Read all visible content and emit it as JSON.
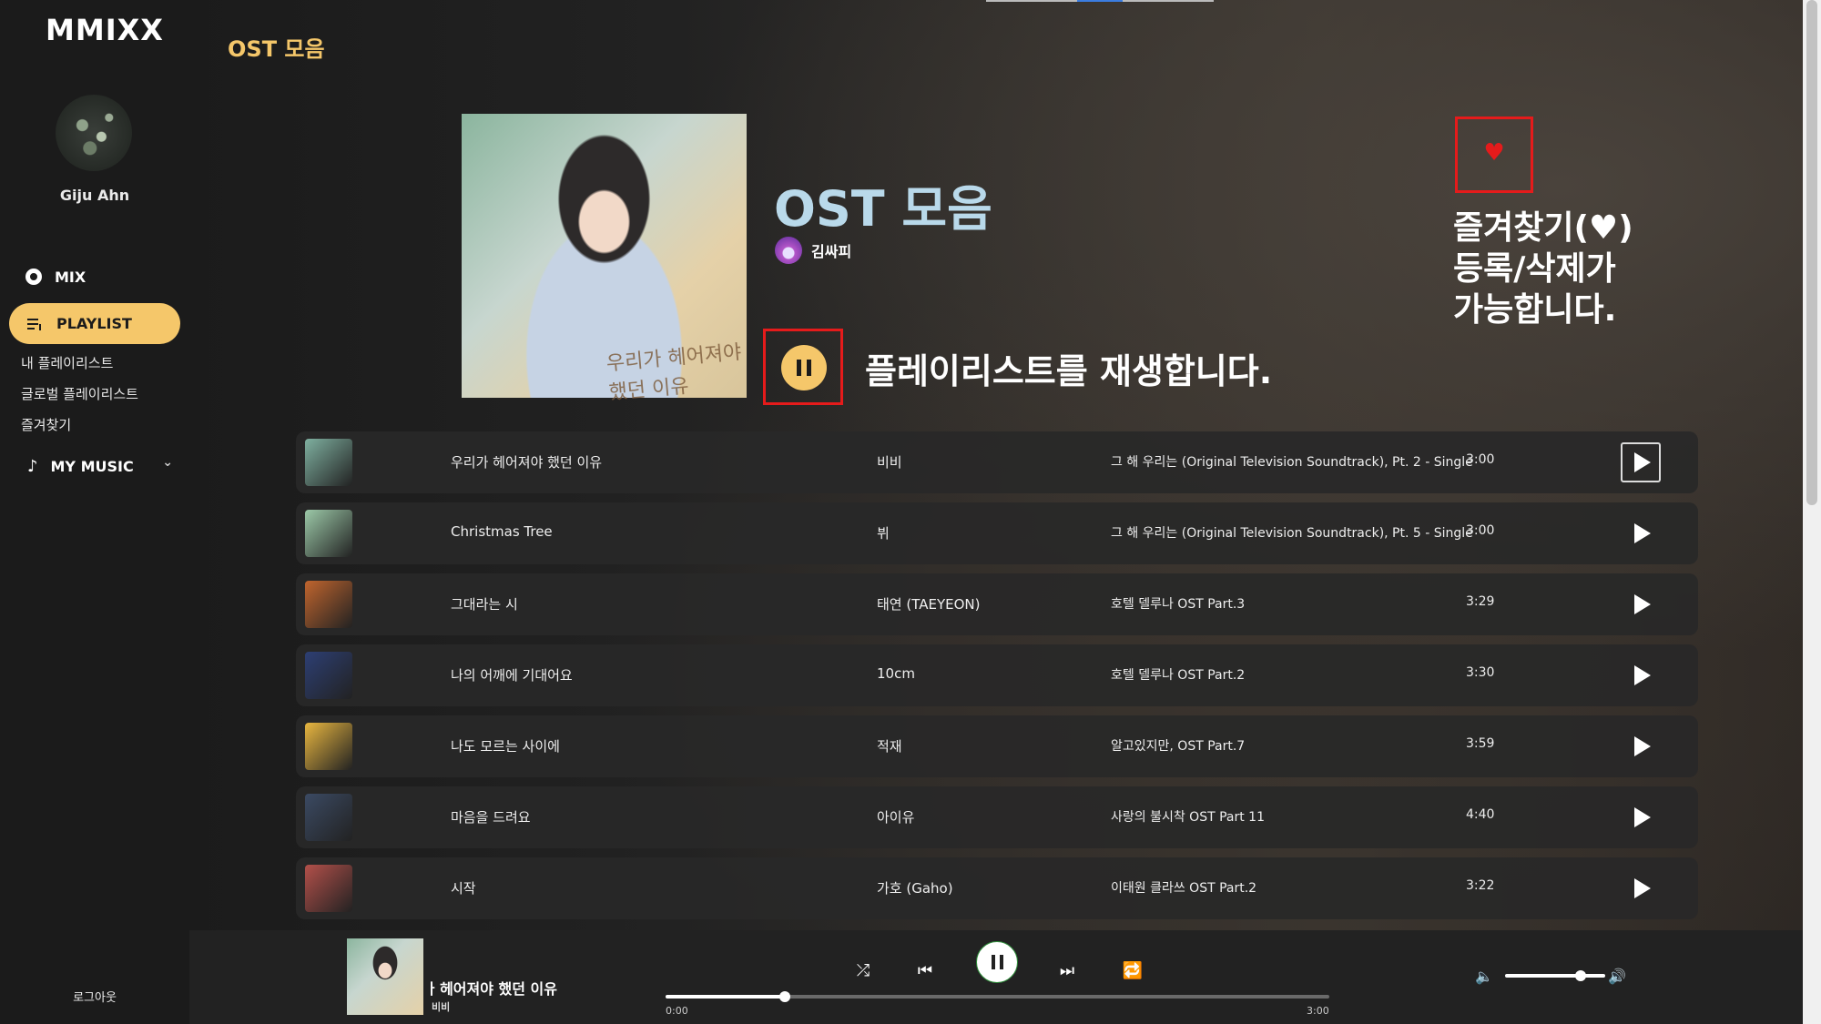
{
  "app": {
    "logo": "MMIXX"
  },
  "sidebar": {
    "username": "Giju Ahn",
    "mix_label": "MIX",
    "playlist_label": "PLAYLIST",
    "sub_items": [
      "내 플레이리스트",
      "글로벌 플레이리스트",
      "즐겨찾기"
    ],
    "mymusic_label": "MY MUSIC",
    "logout_label": "로그아웃"
  },
  "page": {
    "section_title": "OST 모음",
    "album_title": "OST 모음",
    "owner_name": "김싸피",
    "cover_text": "우리가 헤어져야 했던 이유",
    "play_caption": "플레이리스트를 재생합니다.",
    "fav_caption": "즐겨찾기(♥)\n등록/삭제가\n가능합니다."
  },
  "tracks": [
    {
      "title": "우리가 헤어져야 했던 이유",
      "artist": "비비",
      "album": "그 해 우리는 (Original Television Soundtrack), Pt. 2 - Single",
      "duration": "3:00",
      "thumb": "#7fb0a0"
    },
    {
      "title": "Christmas Tree",
      "artist": "뷔",
      "album": "그 해 우리는 (Original Television Soundtrack), Pt. 5 - Single",
      "duration": "3:00",
      "thumb": "#9cc9a8"
    },
    {
      "title": "그대라는 시",
      "artist": "태연 (TAEYEON)",
      "album": "호텔 델루나 OST Part.3",
      "duration": "3:29",
      "thumb": "#c0652e"
    },
    {
      "title": "나의 어깨에 기대어요",
      "artist": "10cm",
      "album": "호텔 델루나 OST Part.2",
      "duration": "3:30",
      "thumb": "#2d3f74"
    },
    {
      "title": "나도 모르는 사이에",
      "artist": "적재",
      "album": "알고있지만, OST Part.7",
      "duration": "3:59",
      "thumb": "#e8b640"
    },
    {
      "title": "마음을 드려요",
      "artist": "아이유",
      "album": "사랑의 불시착 OST Part 11",
      "duration": "4:40",
      "thumb": "#3b4a63"
    },
    {
      "title": "시작",
      "artist": "가호 (Gaho)",
      "album": "이태원 클라쓰 OST Part.2",
      "duration": "3:22",
      "thumb": "#b3504a"
    }
  ],
  "player": {
    "title": "우리가 헤어져야 했던 이유",
    "artist": "비비",
    "time_current": "0:00",
    "time_total": "3:00",
    "progress": 0.18,
    "volume": 0.75
  },
  "colors": {
    "accent": "#f5c76a",
    "highlight_box": "#e51b1b",
    "album_title": "#b9d9ea"
  }
}
